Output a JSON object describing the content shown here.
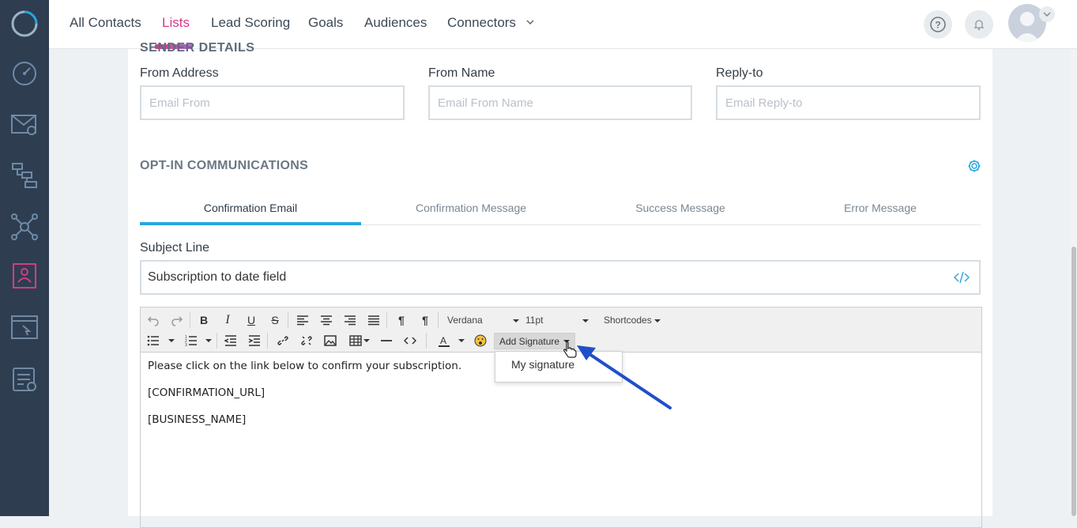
{
  "nav": {
    "items": [
      {
        "label": "All Contacts",
        "active": false
      },
      {
        "label": "Lists",
        "active": true
      },
      {
        "label": "Lead Scoring",
        "active": false
      },
      {
        "label": "Goals",
        "active": false
      },
      {
        "label": "Audiences",
        "active": false
      },
      {
        "label": "Connectors",
        "active": false
      }
    ],
    "accent_color": "#d63a8b"
  },
  "sidebar": {
    "icons": [
      "dashboard-icon",
      "email-icon",
      "automation-icon",
      "network-icon",
      "contacts-icon",
      "landing-page-icon",
      "forms-icon"
    ],
    "active_icon": "contacts-icon"
  },
  "sender": {
    "heading": "SENDER DETAILS",
    "from_address_label": "From Address",
    "from_address_placeholder": "Email From",
    "from_name_label": "From Name",
    "from_name_placeholder": "Email From Name",
    "reply_to_label": "Reply-to",
    "reply_to_placeholder": "Email Reply-to"
  },
  "optin": {
    "title": "OPT-IN COMMUNICATIONS",
    "tabs": [
      {
        "label": "Confirmation Email",
        "active": true
      },
      {
        "label": "Confirmation Message",
        "active": false
      },
      {
        "label": "Success Message",
        "active": false
      },
      {
        "label": "Error Message",
        "active": false
      }
    ],
    "tab_accent": "#27a6de"
  },
  "subject": {
    "label": "Subject Line",
    "value": "Subscription to date field"
  },
  "editor": {
    "font": "Verdana",
    "size": "11pt",
    "shortcodes": "Shortcodes",
    "add_signature": "Add Signature",
    "signature_menu_item": "My signature",
    "body": [
      "Please click on the link below to confirm your subscription.",
      "[CONFIRMATION_URL]",
      "[BUSINESS_NAME]"
    ]
  },
  "annotation_arrow_color": "#1f4fc9"
}
